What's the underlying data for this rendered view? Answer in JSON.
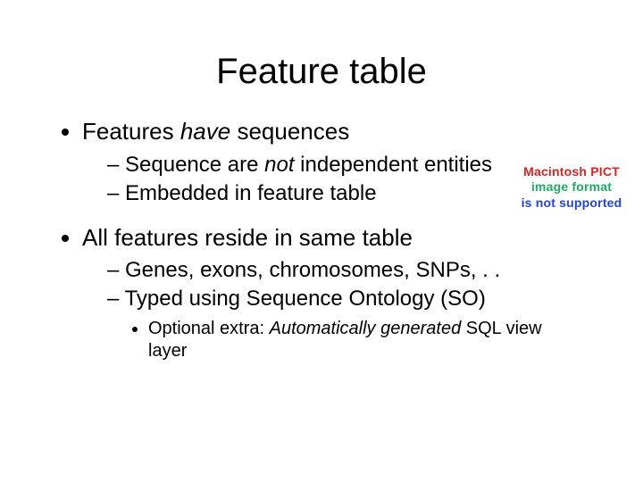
{
  "title": "Feature table",
  "bullets": {
    "b1_pre": "Features ",
    "b1_em": "have",
    "b1_post": " sequences",
    "b1_s1_pre": "Sequence are ",
    "b1_s1_em": "not",
    "b1_s1_post": " independent entities",
    "b1_s2": "Embedded in feature table",
    "b2": "All features reside in same table",
    "b2_s1": "Genes, exons, chromosomes, SNPs, . .",
    "b2_s2": "Typed using Sequence Ontology (SO)",
    "b2_s2_a_pre": "Optional extra: ",
    "b2_s2_a_em": "Automatically generated",
    "b2_s2_a_post": " SQL view layer"
  },
  "placeholder": {
    "line1": "Macintosh PICT",
    "line2": "image format",
    "line3": "is not supported"
  }
}
